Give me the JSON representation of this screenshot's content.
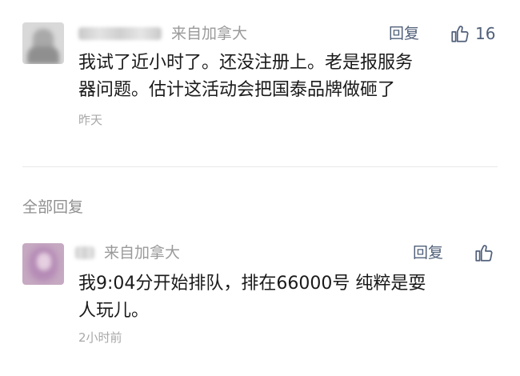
{
  "comments": [
    {
      "origin": "来自加拿大",
      "reply_label": "回复",
      "likes": "16",
      "text_line1": "我试了近小时了。还没注册上。老是报服务",
      "text_line2": "器问题。估计这活动会把国泰品牌做砸了",
      "time": "昨天"
    },
    {
      "origin": "来自加拿大",
      "reply_label": "回复",
      "likes": "",
      "text_line1": "我9:04分开始排队，排在66000号 纯粹是耍",
      "text_line2": "人玩儿。",
      "time": "2小时前"
    }
  ],
  "section": {
    "all_replies": "全部回复"
  },
  "icons": {
    "like": "thumbs-up-icon"
  },
  "colors": {
    "link": "#51607a",
    "muted": "#9a9a9a",
    "text": "#1a1a1a"
  }
}
